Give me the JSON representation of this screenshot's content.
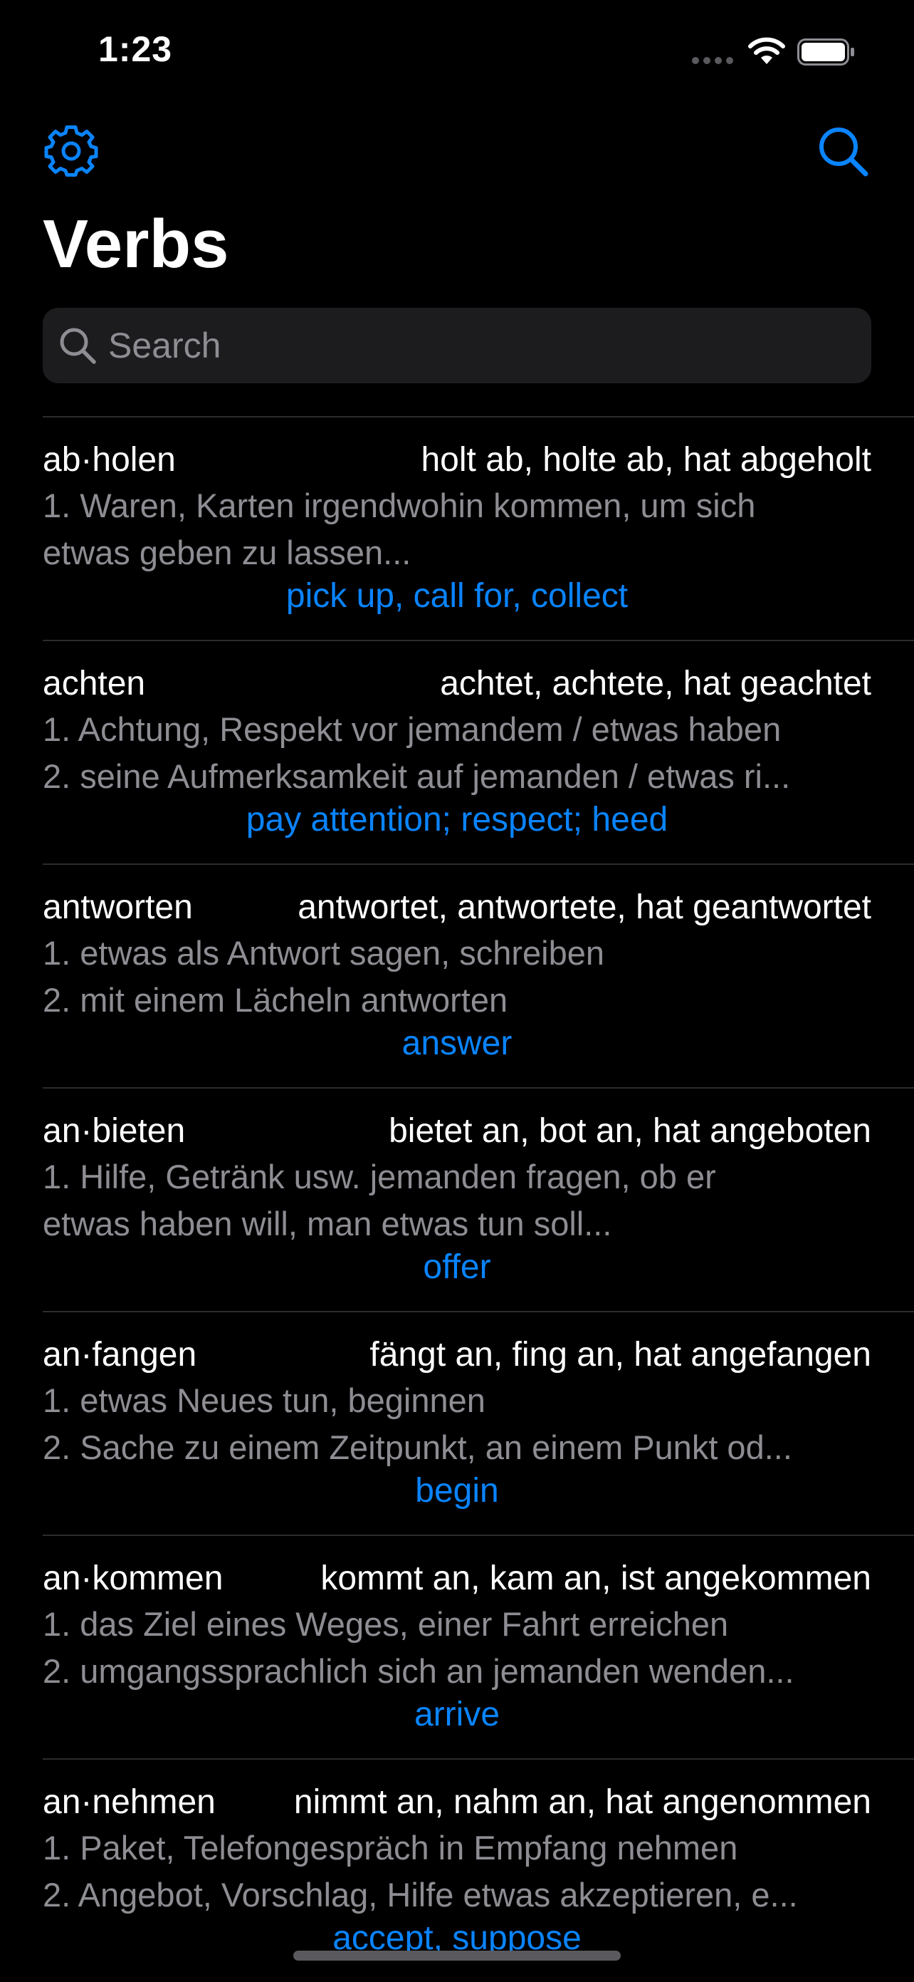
{
  "status_bar": {
    "time": "1:23"
  },
  "nav": {
    "settings_icon": "gear-icon",
    "search_icon": "search-icon"
  },
  "title": "Verbs",
  "search": {
    "placeholder": "Search",
    "value": ""
  },
  "colors": {
    "background": "#000000",
    "accent": "#0a84ff",
    "secondary_text": "#8d8d93",
    "separator": "#2c2c2e",
    "search_fill": "#1c1c1e"
  },
  "verbs": [
    {
      "word": "ab·holen",
      "forms": "holt ab, holte ab, hat abgeholt",
      "def_1": "1. Waren, Karten irgendwohin kommen, um sich",
      "def_2": "etwas geben zu lassen...",
      "translation": "pick up, call for, collect"
    },
    {
      "word": "achten",
      "forms": "achtet, achtete, hat geachtet",
      "def_1": "1. Achtung, Respekt vor jemandem / etwas haben",
      "def_2": "2. seine Aufmerksamkeit auf jemanden / etwas ri...",
      "translation": "pay attention; respect; heed"
    },
    {
      "word": "antworten",
      "forms": "antwortet, antwortete, hat geantwortet",
      "def_1": "1. etwas als Antwort sagen, schreiben",
      "def_2": "2. mit einem Lächeln antworten",
      "translation": "answer"
    },
    {
      "word": "an·bieten",
      "forms": "bietet an, bot an, hat angeboten",
      "def_1": "1. Hilfe, Getränk usw. jemanden fragen, ob er",
      "def_2": "etwas haben will, man etwas tun soll...",
      "translation": "offer"
    },
    {
      "word": "an·fangen",
      "forms": "fängt an, fing an, hat angefangen",
      "def_1": "1. etwas Neues tun, beginnen",
      "def_2": "2. Sache zu einem Zeitpunkt, an einem Punkt od...",
      "translation": "begin"
    },
    {
      "word": "an·kommen",
      "forms": "kommt an, kam an, ist angekommen",
      "def_1": "1. das Ziel eines Weges, einer Fahrt erreichen",
      "def_2": "2. umgangssprachlich sich an jemanden wenden...",
      "translation": "arrive"
    },
    {
      "word": "an·nehmen",
      "forms": "nimmt an, nahm an, hat angenommen",
      "def_1": "1. Paket, Telefongespräch in Empfang nehmen",
      "def_2": "2. Angebot, Vorschlag, Hilfe etwas akzeptieren, e...",
      "translation": "accept, suppose"
    }
  ]
}
